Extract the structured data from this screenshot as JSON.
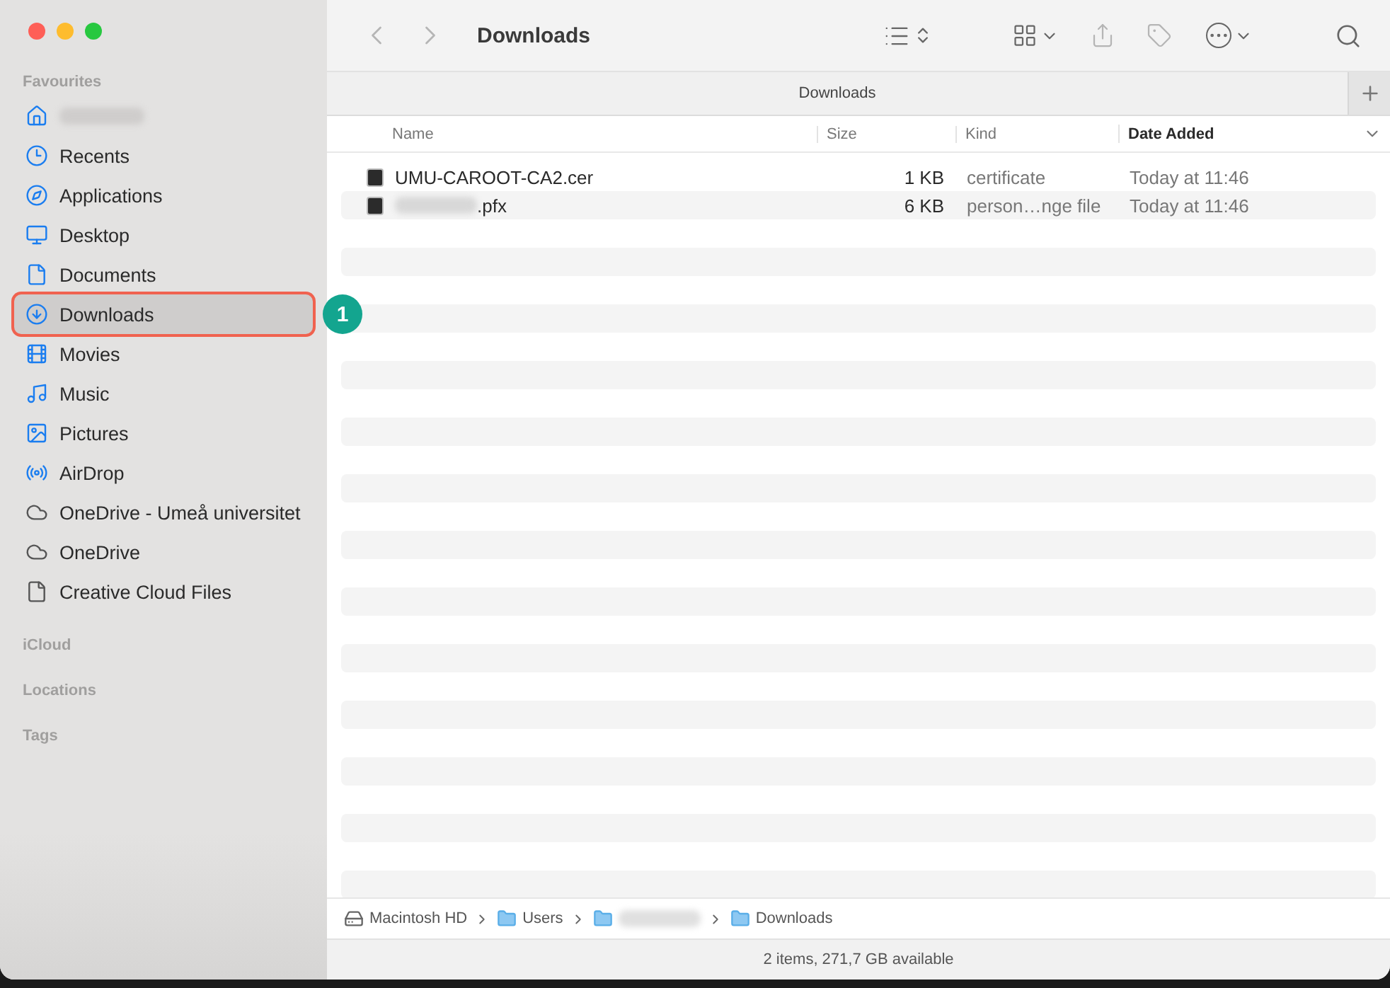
{
  "window": {
    "title": "Downloads",
    "tab_title": "Downloads"
  },
  "sidebar": {
    "sections": [
      {
        "heading": "Favourites",
        "items": [
          {
            "kind": "home",
            "blurred": true,
            "selected": false
          },
          {
            "kind": "recents",
            "label": "Recents",
            "selected": false
          },
          {
            "kind": "applications",
            "label": "Applications",
            "selected": false
          },
          {
            "kind": "desktop",
            "label": "Desktop",
            "selected": false
          },
          {
            "kind": "documents",
            "label": "Documents",
            "selected": false
          },
          {
            "kind": "downloads",
            "label": "Downloads",
            "selected": true,
            "callout": "1"
          },
          {
            "kind": "movies",
            "label": "Movies",
            "selected": false
          },
          {
            "kind": "music",
            "label": "Music",
            "selected": false
          },
          {
            "kind": "pictures",
            "label": "Pictures",
            "selected": false
          },
          {
            "kind": "airdrop",
            "label": "AirDrop",
            "selected": false
          },
          {
            "kind": "cloud",
            "label": "OneDrive - Umeå universitet",
            "selected": false
          },
          {
            "kind": "cloud",
            "label": "OneDrive",
            "selected": false
          },
          {
            "kind": "file",
            "label": "Creative Cloud Files",
            "selected": false
          }
        ]
      },
      {
        "heading": "iCloud"
      },
      {
        "heading": "Locations"
      },
      {
        "heading": "Tags"
      }
    ]
  },
  "table": {
    "columns": [
      {
        "label": "Name",
        "sorted": false
      },
      {
        "label": "Size",
        "sorted": false
      },
      {
        "label": "Kind",
        "sorted": false
      },
      {
        "label": "Date Added",
        "sorted": true
      }
    ],
    "rows": [
      {
        "name": "UMU-CAROOT-CA2.cer",
        "name_blurred": false,
        "size": "1 KB",
        "kind": "certificate",
        "date": "Today at 11:46"
      },
      {
        "name": ".pfx",
        "name_blurred": true,
        "size": "6 KB",
        "kind": "person…nge file",
        "date": "Today at 11:46"
      }
    ]
  },
  "path_bar": [
    {
      "kind": "disk",
      "label": "Macintosh HD"
    },
    {
      "kind": "folder",
      "label": "Users"
    },
    {
      "kind": "home-folder",
      "blurred": true
    },
    {
      "kind": "folder",
      "label": "Downloads"
    }
  ],
  "status_bar": "2 items, 271,7 GB available"
}
